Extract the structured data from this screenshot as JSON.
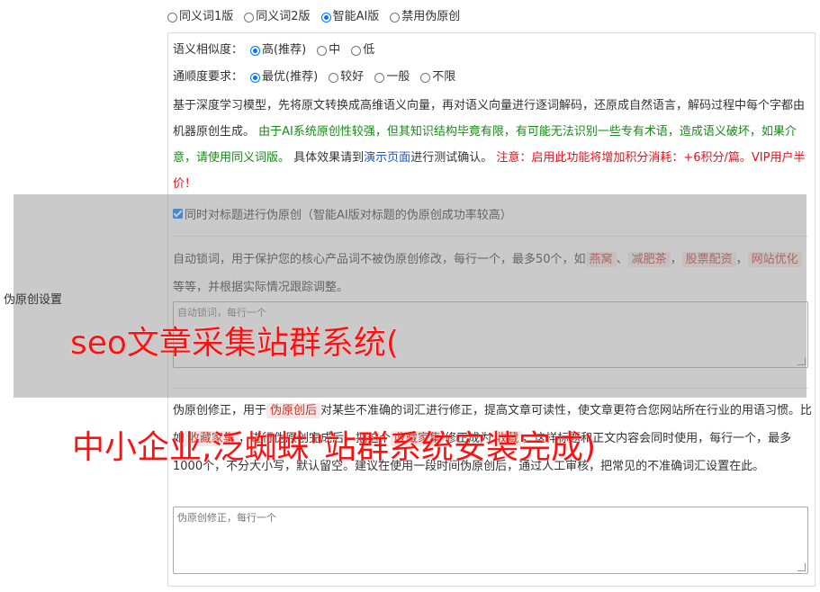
{
  "modes": [
    {
      "label": "同义词1版",
      "checked": false
    },
    {
      "label": "同义词2版",
      "checked": false
    },
    {
      "label": "智能AI版",
      "checked": true
    },
    {
      "label": "禁用伪原创",
      "checked": false
    }
  ],
  "similarity": {
    "label": "语义相似度：",
    "options": [
      {
        "label": "高(推荐)",
        "checked": true
      },
      {
        "label": "中",
        "checked": false
      },
      {
        "label": "低",
        "checked": false
      }
    ]
  },
  "fluency": {
    "label": "通顺度要求：",
    "options": [
      {
        "label": "最优(推荐)",
        "checked": true
      },
      {
        "label": "较好",
        "checked": false
      },
      {
        "label": "一般",
        "checked": false
      },
      {
        "label": "不限",
        "checked": false
      }
    ]
  },
  "description": {
    "part1": "基于深度学习模型，先将原文转换成高维语义向量，再对语义向量进行逐词解码，还原成自然语言，解码过程中每个字都由机器原创生成。",
    "green": "由于AI系统原创性较强，但其知识结构毕竟有限，有可能无法识别一些专有术语，造成语义破坏，如果介意，请使用同义词版。",
    "part2": "具体效果请到",
    "link": "演示页面",
    "part3": "进行测试确认。",
    "red": "注意：启用此功能将增加积分消耗：+6积分/篇。VIP用户半价！"
  },
  "side_label": "伪原创设置",
  "title_check": {
    "label": "同时对标题进行伪原创（智能AI版对标题的伪原创成功率较高）",
    "checked": true
  },
  "lock": {
    "text1": "自动锁词，用于保护您的核心产品词不被伪原创修改，每行一个，最多50个，如",
    "tags": [
      "燕窝",
      "减肥茶",
      "股票配资",
      "网站优化"
    ],
    "sep1": "、",
    "sep2": "，",
    "text2": "等等，并根据实际情况跟踪调整。",
    "placeholder": "自动锁词，每行一个"
  },
  "fix": {
    "text1": "伪原创修正，用于",
    "tag1": "伪原创后",
    "text2": "对某些不准确的词汇进行修正，提高文章可读性，使文章更符合您网站所在行业的用语习惯。比如",
    "tag2": "收藏家集",
    "text3": "，进行伪原创完成后，把这个",
    "tag3": "收藏家集",
    "text4": "修正成为",
    "tag4": "收藏",
    "text5": "，这样标题和正文内容会同时使用，每行一个，最多1000个，不分大小写，默认留空。建议在使用一段时间伪原创后，通过人工审核，把常见的不准确词汇设置在此。",
    "placeholder": "伪原创修正，每行一个"
  },
  "headline": {
    "line1": "seo文章采集站群系统(",
    "line2": "中小企业,泛蜘蛛\"站群系统安装完成)"
  }
}
